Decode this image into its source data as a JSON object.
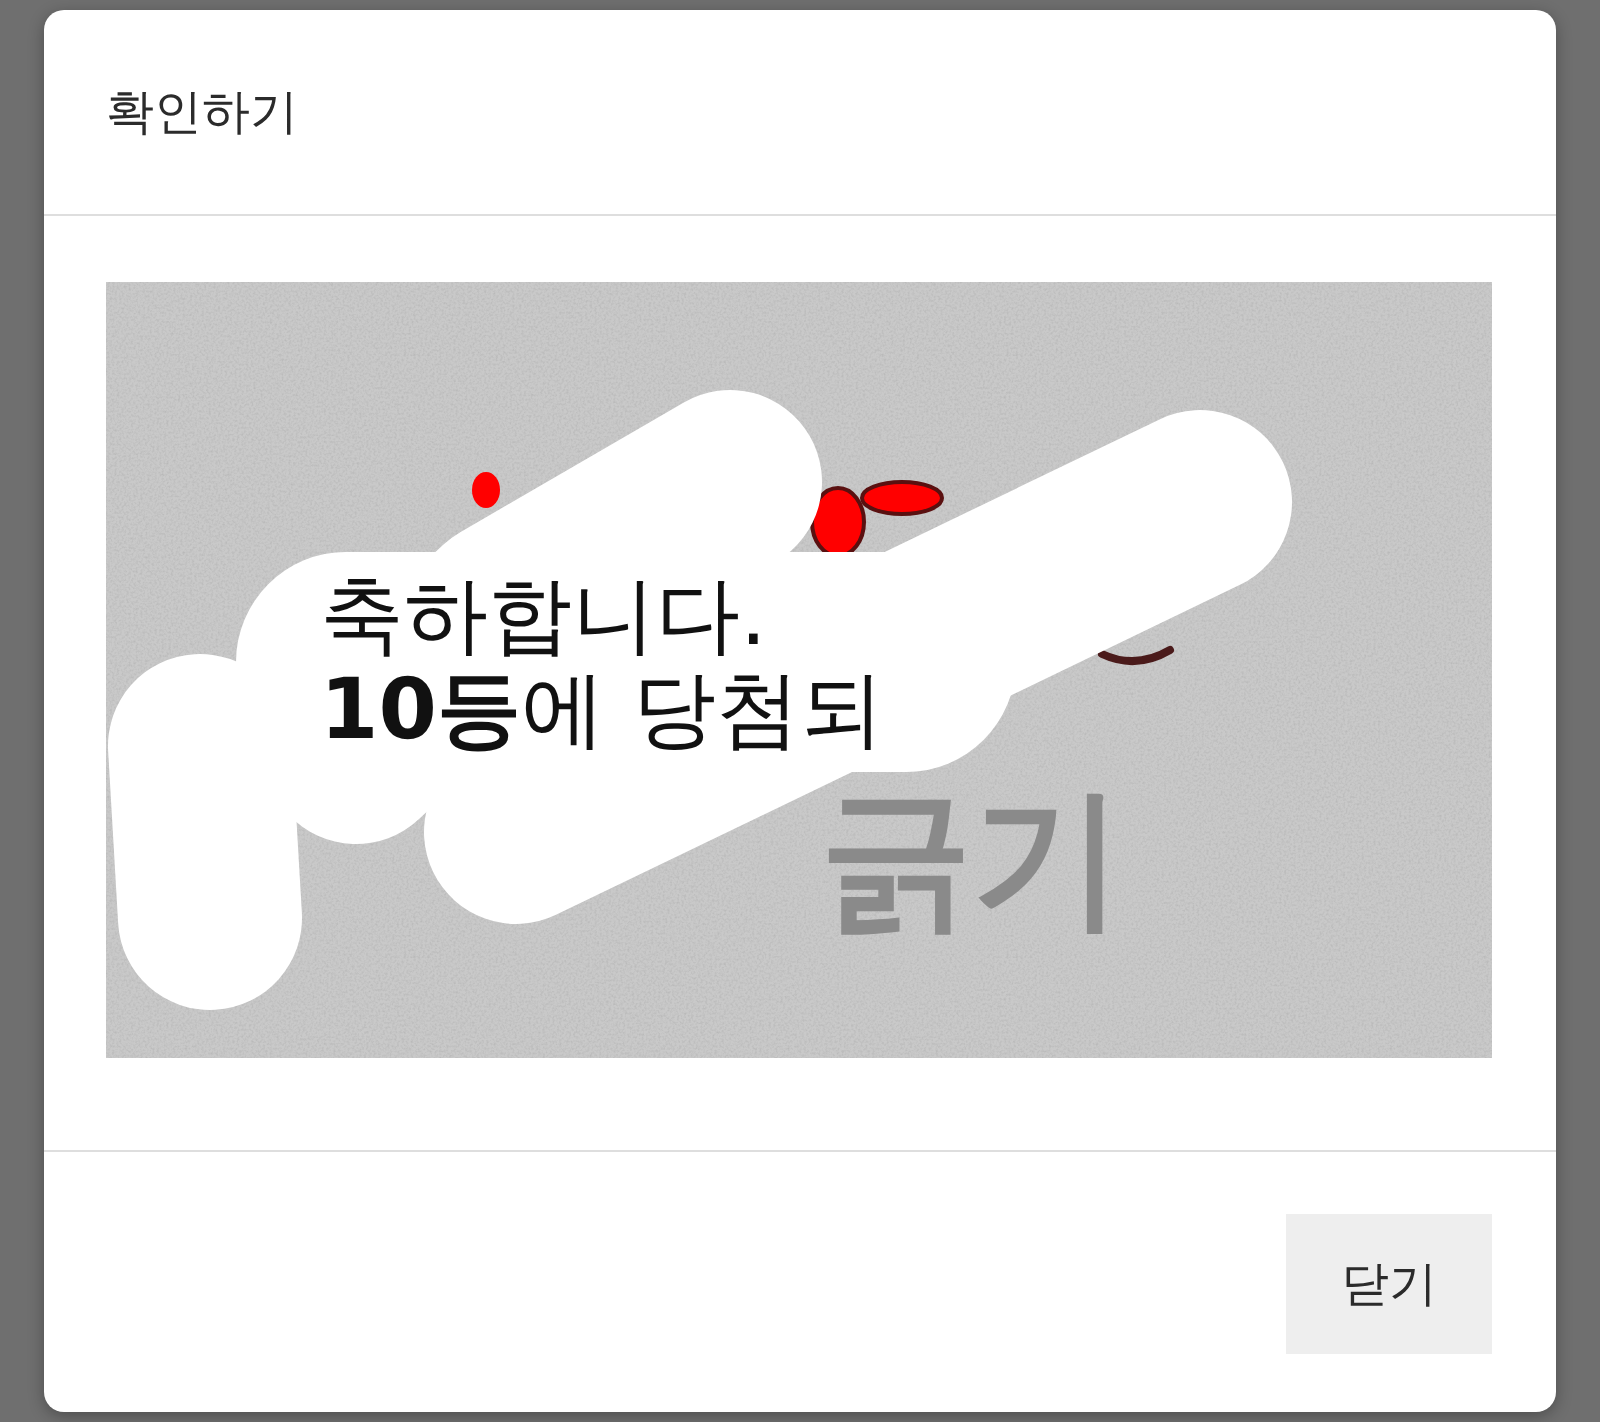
{
  "dialog": {
    "title": "확인하기"
  },
  "scratch_card": {
    "revealed_lines": [
      "축하합니다.",
      "**10등**에 당첨되"
    ],
    "cover_text": "긁기"
  },
  "close_button": {
    "label": "닫기"
  }
}
